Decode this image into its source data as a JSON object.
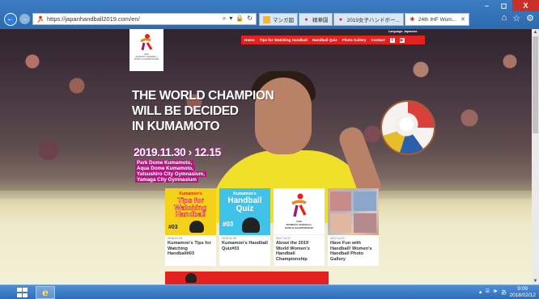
{
  "browser": {
    "url": "https://japanhandball2019.com/en/",
    "tabs": [
      {
        "label": "マンガ図",
        "active": false,
        "icon": "image-icon"
      },
      {
        "label": "精華園",
        "active": false,
        "icon": "red-logo-icon"
      },
      {
        "label": "2019女子ハンドボー...",
        "active": false,
        "icon": "red-logo-icon"
      },
      {
        "label": "24th IHF Wom...",
        "active": true,
        "icon": "handball-logo-icon"
      }
    ],
    "tab_close": "✕",
    "window_controls": {
      "minimize": "–",
      "maximize": "◻",
      "close": "X"
    }
  },
  "site": {
    "language_label": "Language: Japanese",
    "menu": [
      "Home",
      "Tips for Watching Handball",
      "Handball Quiz",
      "Photo Gallery",
      "Contact"
    ],
    "social": [
      "f",
      "▶"
    ],
    "headline": [
      "THE WORLD CHAMPION",
      "WILL BE DECIDED",
      "IN KUMAMOTO"
    ],
    "dates": "2019.11.30 › 12.15",
    "venues": [
      "Park Dome Kumamoto,",
      "Aqua Dome Kumamoto,",
      "Yatsushiro City Gymnasium,",
      "Yamaga City Gymnasium"
    ],
    "cards": [
      {
        "date": "2018.01.29",
        "title": "Kumamon's Tips for Watching Handball#03",
        "img_lines": [
          "Kumamon's",
          "Tips for",
          "Watching",
          "Handball",
          "#03"
        ]
      },
      {
        "date": "2018.01.29",
        "title": "Kumamon's Handball Quiz#03",
        "img_lines": [
          "Kumamon's",
          "Handball",
          "Quiz",
          "#03"
        ]
      },
      {
        "date": "2017.12.27",
        "title": "About the 2019 World Women's Handball Championship",
        "img_lines": [
          "2019",
          "WOMEN'S HANDBALL",
          "WORLD CHAMPIONSHIP"
        ]
      },
      {
        "date": "2017.12.27",
        "title": "Have Fun with Handball! Women's Handball Photo Gallery",
        "img_lines": []
      }
    ]
  },
  "taskbar": {
    "time": "9:09",
    "date": "2018/02/12"
  },
  "colors": {
    "brand_red": "#e3211f",
    "magenta": "#b0187f",
    "taskbar_blue": "#2f6cb6"
  }
}
